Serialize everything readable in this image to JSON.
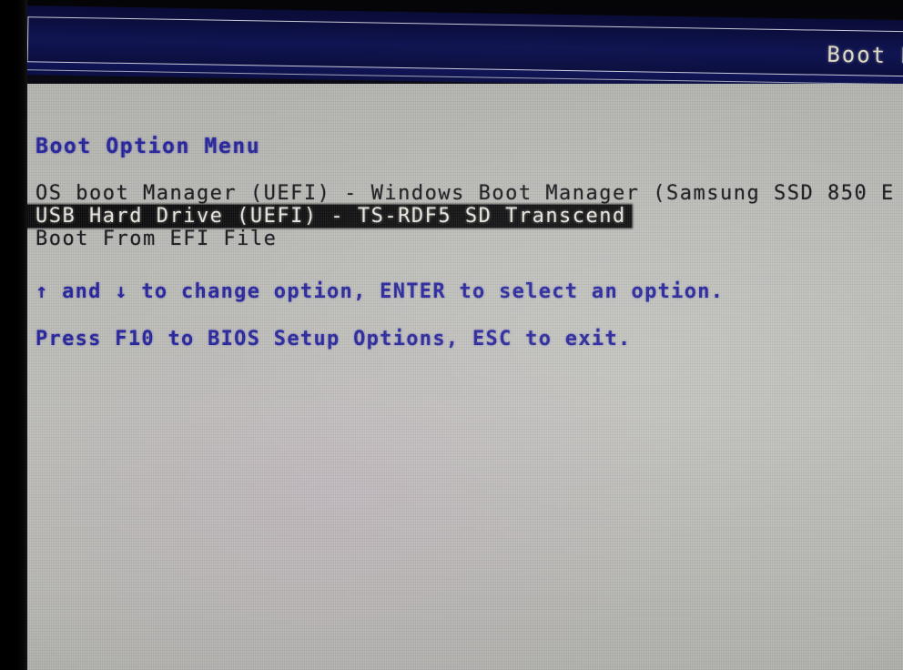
{
  "header": {
    "title": "Boot Man"
  },
  "screen": {
    "menu_title": "Boot Option Menu",
    "options": [
      {
        "label": "OS boot Manager (UEFI) - Windows Boot Manager (Samsung SSD 850 E",
        "selected": false
      },
      {
        "label": "USB Hard Drive (UEFI) - TS-RDF5 SD  Transcend",
        "selected": true
      },
      {
        "label": "Boot From EFI File",
        "selected": false
      }
    ],
    "hints": [
      "↑ and ↓ to change option, ENTER to select an option.",
      "Press F10 to BIOS Setup Options, ESC to exit."
    ]
  },
  "colors": {
    "header_background": "#101552",
    "header_text": "#dedac4",
    "screen_background": "#bcbdb8",
    "menu_title_text": "#24219c",
    "option_text": "#16161c",
    "selected_background": "#09090b",
    "selected_text": "#eceae2",
    "hint_text": "#24219c",
    "bezel": "#000000"
  }
}
